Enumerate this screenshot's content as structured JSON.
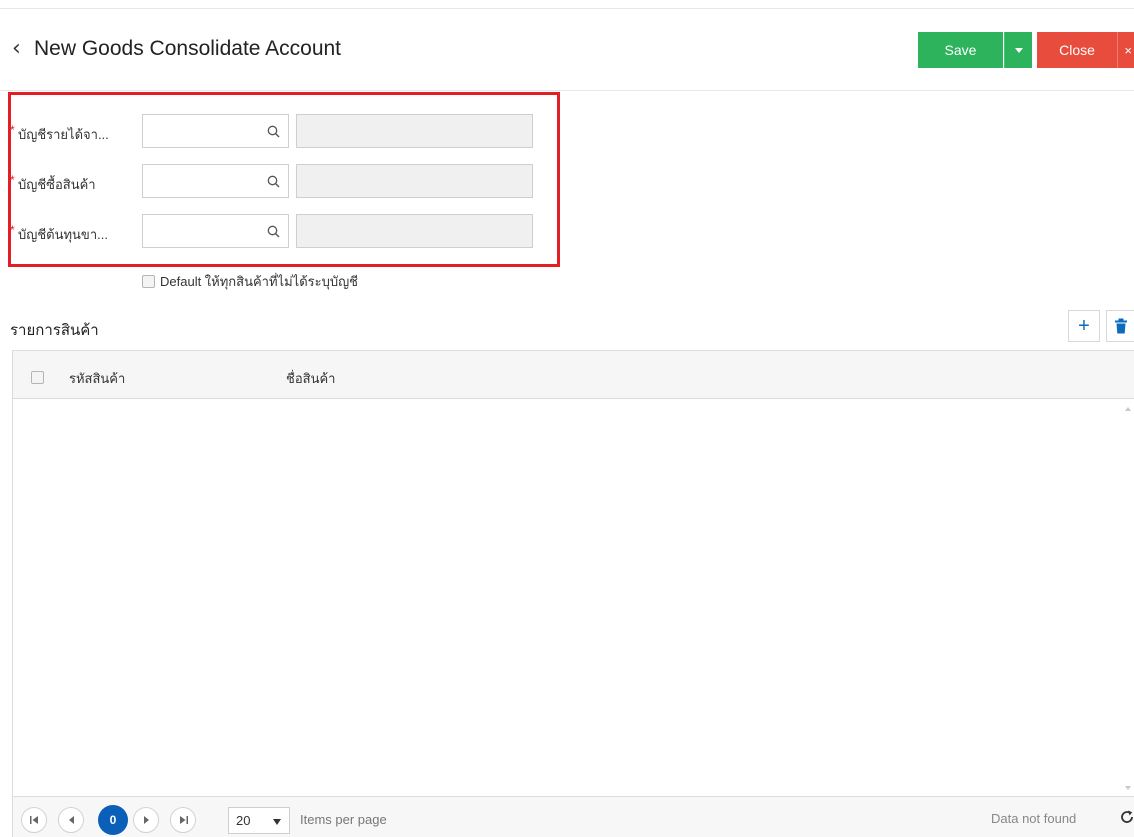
{
  "header": {
    "title": "New Goods Consolidate Account",
    "save_label": "Save",
    "close_label": "Close",
    "close_x": "×"
  },
  "form": {
    "fields": [
      {
        "required": "*",
        "label": "บัญชีรายได้จา...",
        "value": "",
        "name_value": ""
      },
      {
        "required": "*",
        "label": "บัญชีซื้อสินค้า",
        "value": "",
        "name_value": ""
      },
      {
        "required": "*",
        "label": "บัญชีต้นทุนขา...",
        "value": "",
        "name_value": ""
      }
    ],
    "default_checkbox_label": "Default ให้ทุกสินค้าที่ไม่ได้ระบุบัญชี"
  },
  "items_section": {
    "title": "รายการสินค้า",
    "add_label": "+",
    "columns": [
      "รหัสสินค้า",
      "ชื่อสินค้า"
    ],
    "rows": []
  },
  "pager": {
    "current_page": "0",
    "page_size": "20",
    "items_per_page_label": "Items per page",
    "status": "Data not found"
  },
  "colors": {
    "save": "#2cb35c",
    "close": "#e74c3c",
    "highlight": "#e31e24",
    "primary": "#0b5fb8"
  }
}
